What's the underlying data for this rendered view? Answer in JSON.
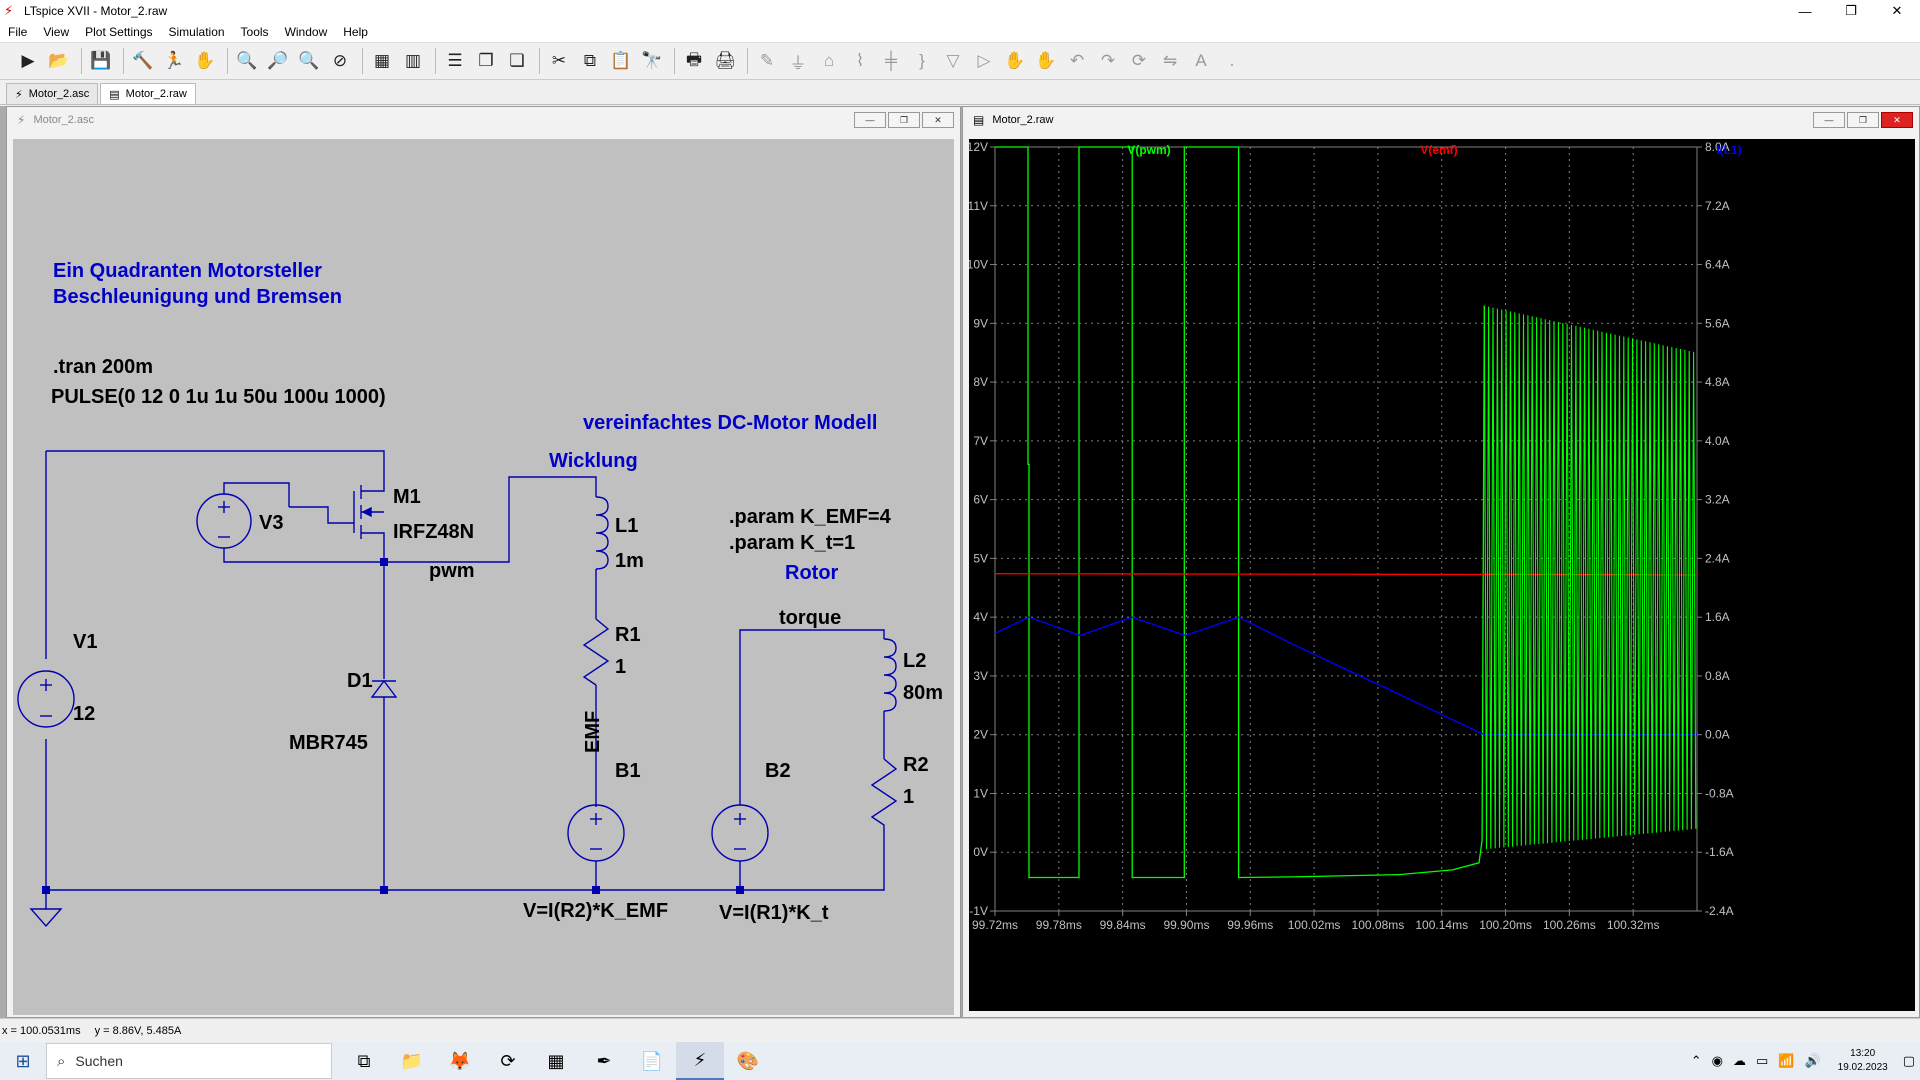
{
  "window": {
    "title": "LTspice XVII - Motor_2.raw",
    "minimize": "—",
    "restore": "❐",
    "close": "✕"
  },
  "menu": [
    "File",
    "View",
    "Plot Settings",
    "Simulation",
    "Tools",
    "Window",
    "Help"
  ],
  "tabs": [
    {
      "label": "Motor_2.asc",
      "icon": "schematic-icon"
    },
    {
      "label": "Motor_2.raw",
      "icon": "waveform-icon"
    }
  ],
  "schematic": {
    "title": "Motor_2.asc",
    "heading1": "Ein Quadranten Motorsteller",
    "heading2": "Beschleunigung und Bremsen",
    "tran": ".tran 200m",
    "pulse": "PULSE(0 12 0 1u 1u 50u 100u 1000)",
    "motor_model": "vereinfachtes DC-Motor Modell",
    "winding": "Wicklung",
    "rotor": "Rotor",
    "param1": ".param K_EMF=4",
    "param2": ".param K_t=1",
    "net_pwm": "pwm",
    "net_emf": "EMF",
    "net_torque": "torque",
    "components": {
      "M1": {
        "name": "M1",
        "value": "IRFZ48N"
      },
      "V3": {
        "name": "V3"
      },
      "V1": {
        "name": "V1",
        "value": "12"
      },
      "D1": {
        "name": "D1",
        "value": "MBR745"
      },
      "L1": {
        "name": "L1",
        "value": "1m"
      },
      "R1": {
        "name": "R1",
        "value": "1"
      },
      "B1": {
        "name": "B1",
        "value": "V=I(R2)*K_EMF"
      },
      "B2": {
        "name": "B2",
        "value": "V=I(R1)*K_t"
      },
      "L2": {
        "name": "L2",
        "value": "80m"
      },
      "R2": {
        "name": "R2",
        "value": "1"
      }
    }
  },
  "waveform": {
    "title": "Motor_2.raw",
    "traces": [
      {
        "name": "V(pwm)",
        "color": "#00ff00"
      },
      {
        "name": "V(emf)",
        "color": "#ff0000"
      },
      {
        "name": "I(L1)",
        "color": "#0000ff"
      }
    ],
    "y_left_ticks": [
      "12V",
      "11V",
      "10V",
      "9V",
      "8V",
      "7V",
      "6V",
      "5V",
      "4V",
      "3V",
      "2V",
      "1V",
      "0V",
      "-1V"
    ],
    "y_right_ticks": [
      "8.0A",
      "7.2A",
      "6.4A",
      "5.6A",
      "4.8A",
      "4.0A",
      "3.2A",
      "2.4A",
      "1.6A",
      "0.8A",
      "0.0A",
      "-0.8A",
      "-1.6A",
      "-2.4A"
    ],
    "x_ticks": [
      "99.72ms",
      "99.78ms",
      "99.84ms",
      "99.90ms",
      "99.96ms",
      "100.02ms",
      "100.08ms",
      "100.14ms",
      "100.20ms",
      "100.26ms",
      "100.32ms"
    ]
  },
  "chart_data": {
    "type": "line",
    "x_unit": "ms",
    "xlim": [
      99.72,
      100.38
    ],
    "ylim_left": [
      -1,
      12
    ],
    "ylim_right": [
      -2.4,
      8.0
    ],
    "grid": true,
    "series": [
      {
        "name": "V(pwm)",
        "axis": "left",
        "x": [
          99.72,
          99.751,
          99.751,
          99.752,
          99.752,
          99.799,
          99.799,
          99.8,
          99.8,
          99.849,
          99.849,
          99.898,
          99.898,
          99.899,
          99.899,
          99.949,
          99.949,
          99.95,
          99.95,
          100.0,
          100.1,
          100.15,
          100.175,
          100.178,
          100.18
        ],
        "y": [
          12,
          12,
          6.6,
          6.6,
          -0.43,
          -0.43,
          12,
          12,
          12,
          12,
          -0.43,
          -0.43,
          12,
          12,
          12,
          12,
          -0.43,
          -0.43,
          -0.43,
          -0.42,
          -0.38,
          -0.3,
          -0.18,
          0.2,
          9.3
        ]
      },
      {
        "name": "V(emf)",
        "axis": "left",
        "x": [
          99.72,
          100.38
        ],
        "y": [
          4.74,
          4.72
        ]
      },
      {
        "name": "I(L1)",
        "axis": "right",
        "x": [
          99.72,
          99.752,
          99.8,
          99.849,
          99.899,
          99.949,
          100.0,
          100.1,
          100.18,
          100.38
        ],
        "y": [
          1.38,
          1.6,
          1.35,
          1.6,
          1.35,
          1.6,
          1.23,
          0.55,
          0.0,
          0.0
        ]
      }
    ]
  },
  "status": {
    "x": "x = 100.0531ms",
    "y": "y = 8.86V, 5.485A"
  },
  "taskbar": {
    "search": "Suchen",
    "time": "13:20",
    "date": "19.02.2023"
  }
}
